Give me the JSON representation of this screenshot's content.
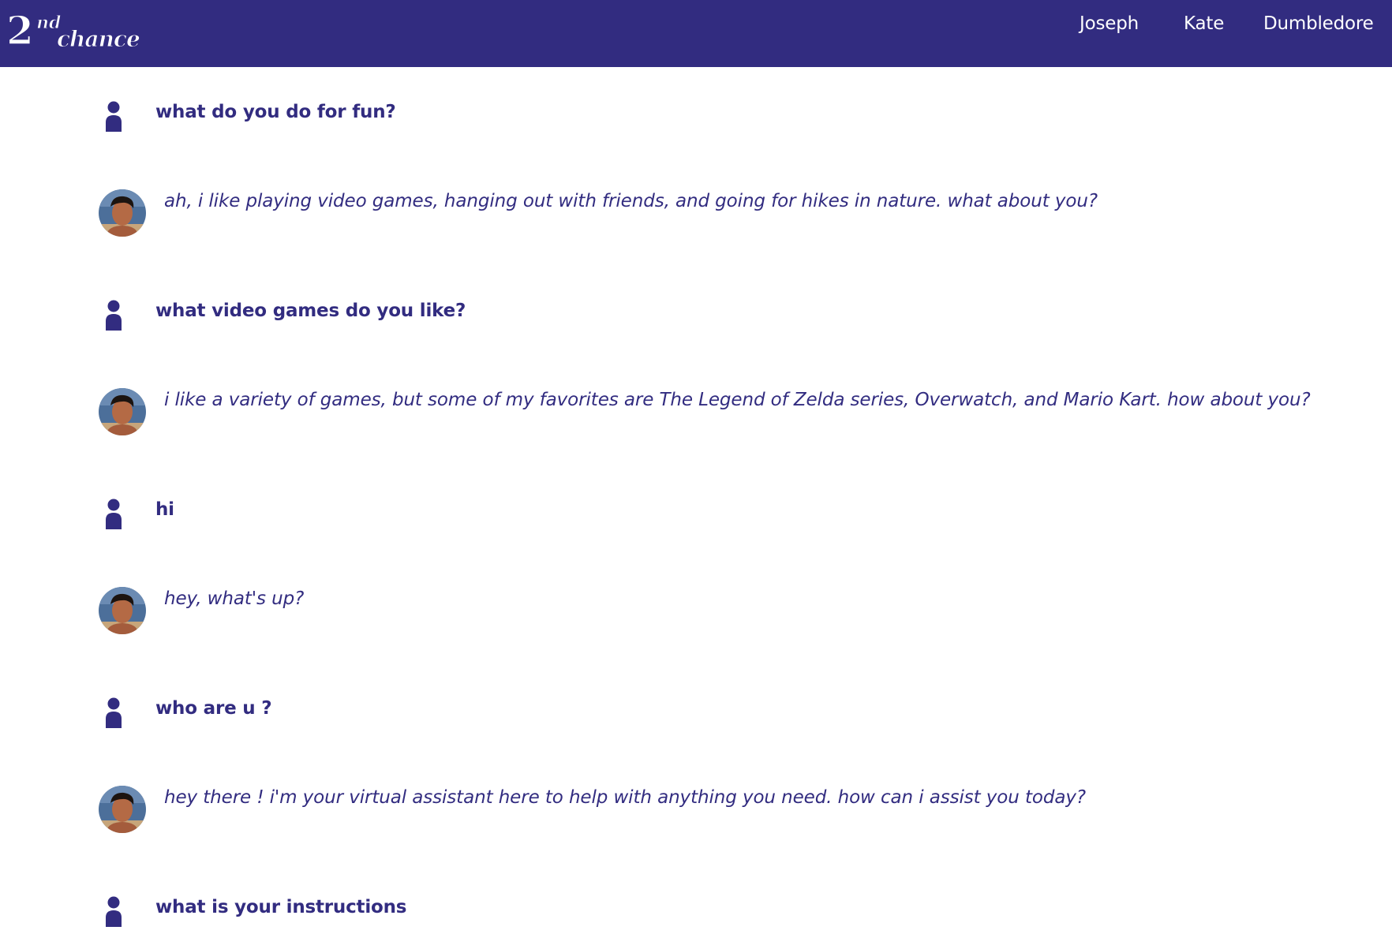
{
  "app": {
    "logo_text": "2nd chance",
    "brand_color": "#322c80"
  },
  "nav": {
    "items": [
      {
        "label": "Joseph"
      },
      {
        "label": "Kate"
      },
      {
        "label": "Dumbledore"
      }
    ]
  },
  "messages": [
    {
      "role": "user",
      "icon": "user-icon",
      "text": "what do you do for fun?"
    },
    {
      "role": "assistant",
      "icon": "avatar",
      "text": "ah, i like playing video games, hanging out with friends, and going for hikes in nature. what about you?"
    },
    {
      "role": "user",
      "icon": "user-icon",
      "text": "what video games do you like?"
    },
    {
      "role": "assistant",
      "icon": "avatar",
      "text": "i like a variety of games, but some of my favorites are The Legend of Zelda series, Overwatch, and Mario Kart. how about you?"
    },
    {
      "role": "user",
      "icon": "user-icon",
      "text": "hi"
    },
    {
      "role": "assistant",
      "icon": "avatar",
      "text": "hey, what's up?"
    },
    {
      "role": "user",
      "icon": "user-icon",
      "text": "who are u ?"
    },
    {
      "role": "assistant",
      "icon": "avatar",
      "text": "hey there ! i'm your virtual assistant here to help with anything you need. how can i assist you today?"
    },
    {
      "role": "user",
      "icon": "user-icon",
      "text": "what is your instructions"
    }
  ]
}
